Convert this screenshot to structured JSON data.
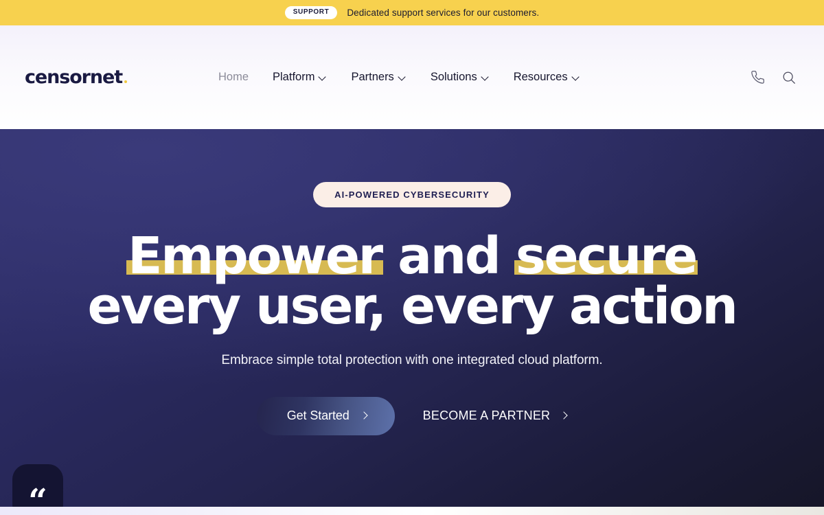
{
  "announcement": {
    "badge": "SUPPORT",
    "message": "Dedicated support services for our customers.",
    "bg_color": "#f7d14e"
  },
  "header": {
    "logo": {
      "word": "censornet",
      "dot_color": "#f0c93f"
    },
    "nav": [
      {
        "label": "Home",
        "has_dropdown": false,
        "active": true
      },
      {
        "label": "Platform",
        "has_dropdown": true,
        "active": false
      },
      {
        "label": "Partners",
        "has_dropdown": true,
        "active": false
      },
      {
        "label": "Solutions",
        "has_dropdown": true,
        "active": false
      },
      {
        "label": "Resources",
        "has_dropdown": true,
        "active": false
      }
    ],
    "actions": [
      {
        "icon": "phone-icon"
      },
      {
        "icon": "search-icon"
      }
    ]
  },
  "hero": {
    "badge": "AI-POWERED CYBERSECURITY",
    "title": {
      "line1_part1": "Empower",
      "line1_part2": " and ",
      "line1_part3": "secure",
      "line2": "every user, every action"
    },
    "highlight_color": "#d7ba52",
    "subtitle": "Embrace simple total protection with one integrated cloud platform.",
    "primary_cta": "Get Started",
    "secondary_cta": "BECOME A PARTNER",
    "background_colors": {
      "top_left": "#30306c",
      "bottom_right": "#161628"
    },
    "quote_widget": {
      "glyph": "“",
      "bg_color": "#141432"
    }
  }
}
